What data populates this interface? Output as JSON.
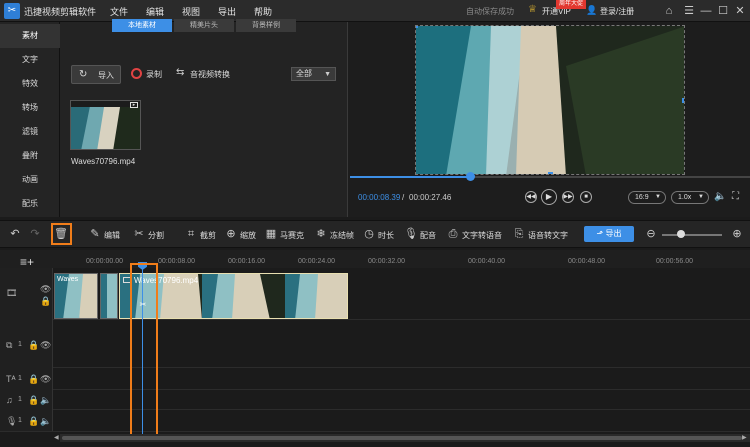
{
  "app": {
    "title": "迅捷视频剪辑软件",
    "menu": [
      "文件",
      "编辑",
      "视图",
      "导出",
      "帮助"
    ],
    "autosave": "自动保存成功",
    "vip_label": "开通VIP",
    "vip_badge": "周年大促",
    "login": "登录/注册"
  },
  "leftnav": {
    "items": [
      "素材",
      "文字",
      "特效",
      "转场",
      "滤镜",
      "叠附",
      "动画",
      "配乐"
    ],
    "active_index": 0
  },
  "library": {
    "tabs": [
      "本地素材",
      "精美片头",
      "背景样例"
    ],
    "active_tab": 0,
    "import_label": "导入",
    "record_label": "录制",
    "convert_label": "音视频转换",
    "filter_value": "全部",
    "media": [
      {
        "name": "Waves70796.mp4"
      }
    ]
  },
  "preview": {
    "current_time": "00:00:08.39",
    "separator": "/",
    "total_time": "00:00:27.46",
    "aspect": "16:9",
    "speed": "1.0x",
    "progress": 0.3
  },
  "toolbar": {
    "edit": "编辑",
    "split": "分割",
    "crop": "截剪",
    "zoom": "缩放",
    "mosaic": "马赛克",
    "freeze": "冻结帧",
    "duration": "时长",
    "voiceover": "配音",
    "tts": "文字转语音",
    "stt": "语音转文字",
    "export": "导出"
  },
  "timeline": {
    "ticks": [
      "00:00:00.00",
      "00:00:08.00",
      "00:00:16.00",
      "00:00:24.00",
      "00:00:32.00",
      "00:00:40.00",
      "00:00:48.00",
      "00:00:56.00"
    ],
    "clips": [
      {
        "label": "Waves"
      },
      {
        "label": ""
      },
      {
        "label": "Waves70796.mp4"
      }
    ],
    "track_numbers": [
      "1",
      "1",
      "1",
      "1"
    ]
  }
}
